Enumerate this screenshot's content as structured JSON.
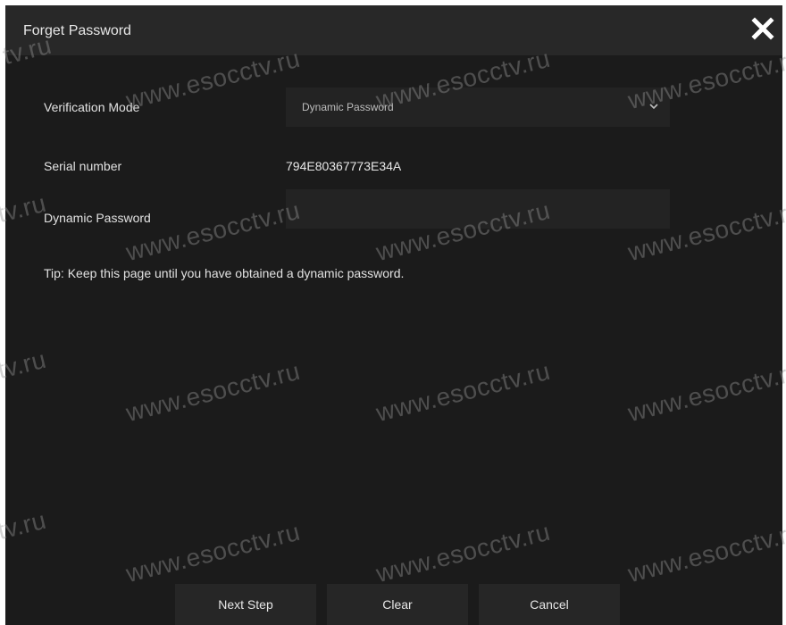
{
  "dialog": {
    "title": "Forget Password",
    "close_icon": "close-icon"
  },
  "form": {
    "verification_mode": {
      "label": "Verification Mode",
      "selected": "Dynamic Password",
      "icon": "chevron-down-icon"
    },
    "serial_number": {
      "label": "Serial number",
      "value": "794E80367773E34A"
    },
    "dynamic_password": {
      "label": "Dynamic Password",
      "value": ""
    },
    "tip": "Tip: Keep this page until you have obtained a dynamic password."
  },
  "buttons": {
    "next": "Next Step",
    "clear": "Clear",
    "cancel": "Cancel"
  },
  "watermark": {
    "text": "www.esocctv.ru",
    "fragment": "tv.ru",
    "color": "#969696"
  },
  "colors": {
    "dialog_bg": "#1b1b1b",
    "titlebar_bg": "#282828",
    "field_bg": "#232323",
    "button_bg": "#262626"
  }
}
